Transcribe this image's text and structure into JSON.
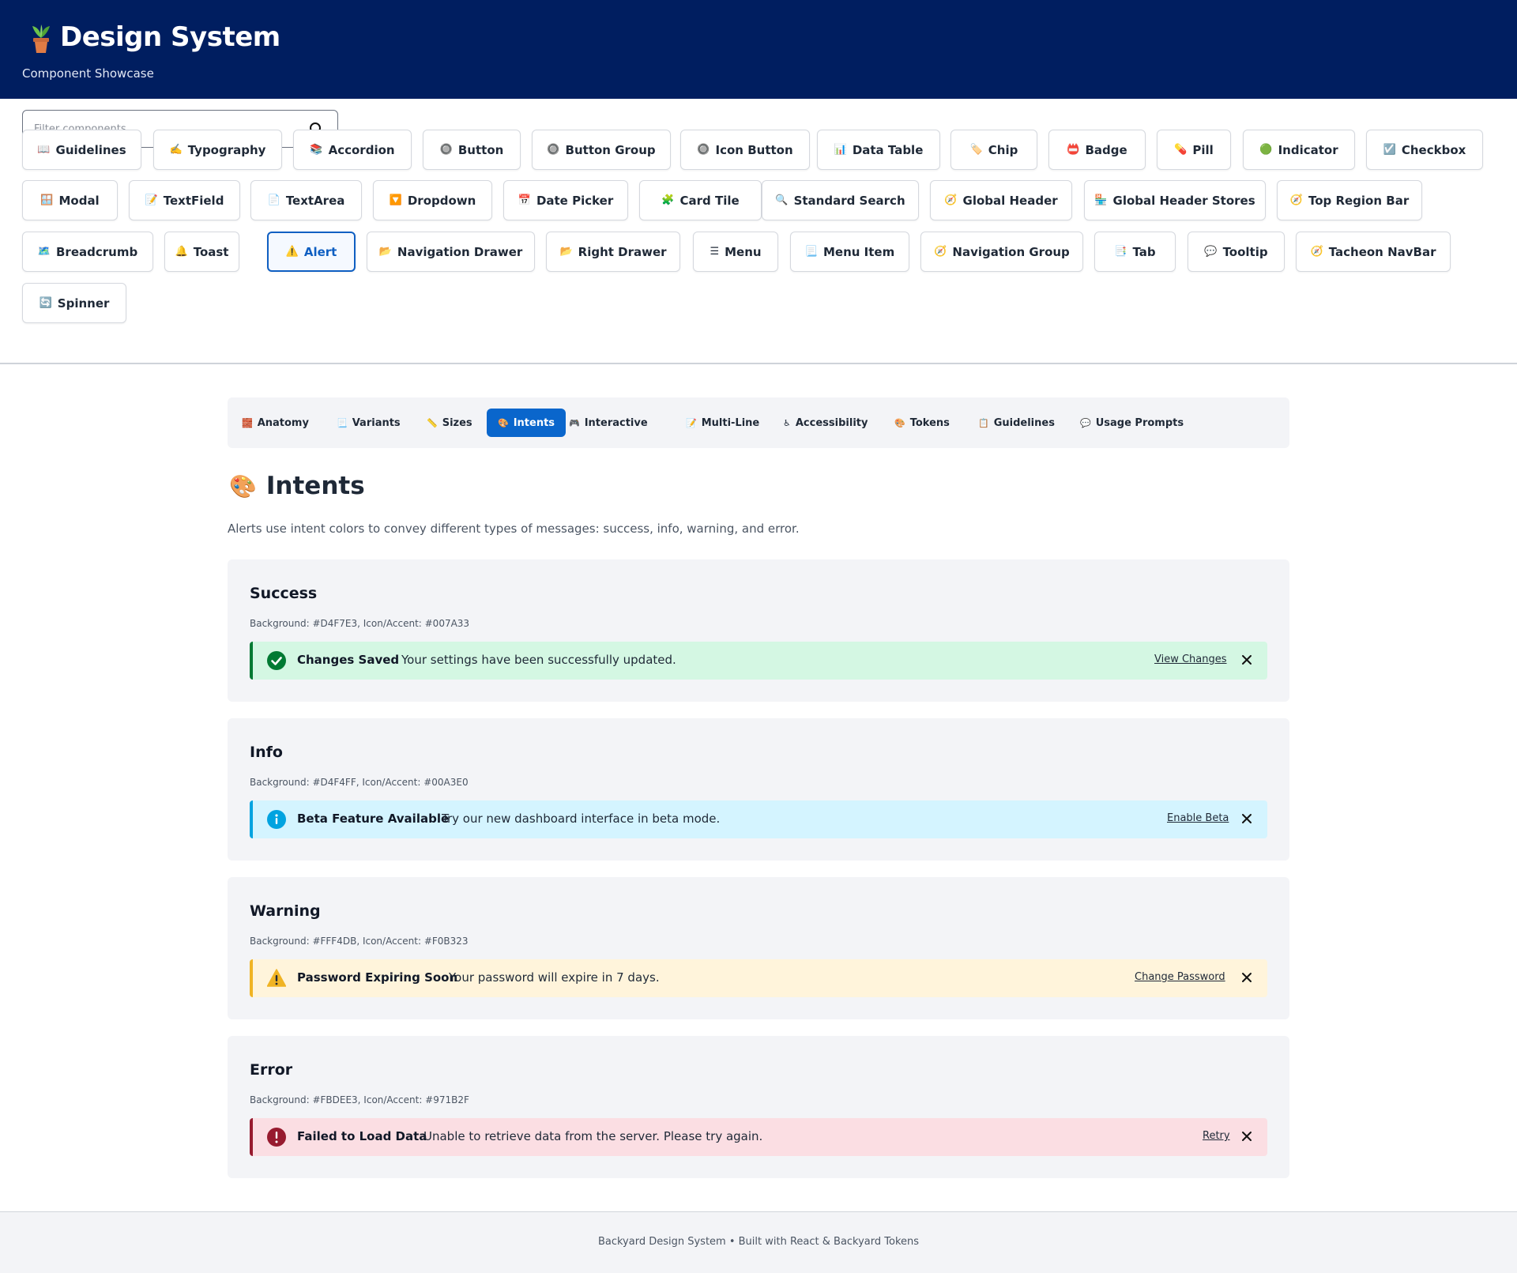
{
  "header": {
    "logo_icon": "potted-plant-icon",
    "title": "Design System",
    "subtitle": "Component Showcase",
    "bg_color": "#001E60"
  },
  "search": {
    "placeholder": "Filter components...",
    "value": "",
    "icon": "search-icon"
  },
  "components": [
    {
      "emoji": "📖",
      "label": "Guidelines"
    },
    {
      "emoji": "✍️",
      "label": "Typography"
    },
    {
      "emoji": "📚",
      "label": "Accordion"
    },
    {
      "emoji": "🔘",
      "label": "Button"
    },
    {
      "emoji": "🔘",
      "label": "Button Group"
    },
    {
      "emoji": "🔘",
      "label": "Icon Button"
    },
    {
      "emoji": "📊",
      "label": "Data Table"
    },
    {
      "emoji": "🏷️",
      "label": "Chip"
    },
    {
      "emoji": "📛",
      "label": "Badge"
    },
    {
      "emoji": "💊",
      "label": "Pill"
    },
    {
      "emoji": "🟢",
      "label": "Indicator"
    },
    {
      "emoji": "☑️",
      "label": "Checkbox"
    },
    {
      "emoji": "🪟",
      "label": "Modal"
    },
    {
      "emoji": "📝",
      "label": "TextField"
    },
    {
      "emoji": "📄",
      "label": "TextArea"
    },
    {
      "emoji": "🔽",
      "label": "Dropdown"
    },
    {
      "emoji": "📅",
      "label": "Date Picker"
    },
    {
      "emoji": "🧩",
      "label": "Card Tile"
    },
    {
      "emoji": "🔍",
      "label": "Standard Search"
    },
    {
      "emoji": "🧭",
      "label": "Global Header"
    },
    {
      "emoji": "🏪",
      "label": "Global Header Stores"
    },
    {
      "emoji": "🧭",
      "label": "Top Region Bar"
    },
    {
      "emoji": "🗺️",
      "label": "Breadcrumb"
    },
    {
      "emoji": "🔔",
      "label": "Toast"
    },
    {
      "emoji": "⚠️",
      "label": "Alert"
    },
    {
      "emoji": "📂",
      "label": "Navigation Drawer"
    },
    {
      "emoji": "📂",
      "label": "Right Drawer"
    },
    {
      "emoji": "☰",
      "label": "Menu"
    },
    {
      "emoji": "📃",
      "label": "Menu Item"
    },
    {
      "emoji": "🧭",
      "label": "Navigation Group"
    },
    {
      "emoji": "📑",
      "label": "Tab"
    },
    {
      "emoji": "💬",
      "label": "Tooltip"
    },
    {
      "emoji": "🧭",
      "label": "Tacheon NavBar"
    },
    {
      "emoji": "🔄",
      "label": "Spinner"
    }
  ],
  "active_component": "Alert",
  "tabs": [
    {
      "emoji": "🧱",
      "label": "Anatomy"
    },
    {
      "emoji": "📃",
      "label": "Variants"
    },
    {
      "emoji": "📏",
      "label": "Sizes"
    },
    {
      "emoji": "🎨",
      "label": "Intents"
    },
    {
      "emoji": "🎮",
      "label": "Interactive"
    },
    {
      "emoji": "📝",
      "label": "Multi-Line"
    },
    {
      "emoji": "♿",
      "label": "Accessibility"
    },
    {
      "emoji": "🎨",
      "label": "Tokens"
    },
    {
      "emoji": "📋",
      "label": "Guidelines"
    },
    {
      "emoji": "💬",
      "label": "Usage Prompts"
    }
  ],
  "active_tab": "Intents",
  "section": {
    "emoji": "🎨",
    "title": "Intents",
    "description": "Alerts use intent colors to convey different types of messages: success, info, warning, and error."
  },
  "intents": [
    {
      "heading": "Success",
      "meta": "Background: #D4F7E3, Icon/Accent: #007A33",
      "bg": "#D4F7E3",
      "accent": "#007A33",
      "icon": "check-circle-icon",
      "alert_title": "Changes Saved",
      "alert_message": "Your settings have been successfully updated.",
      "link": "View Changes"
    },
    {
      "heading": "Info",
      "meta": "Background: #D4F4FF, Icon/Accent: #00A3E0",
      "bg": "#D4F4FF",
      "accent": "#00A3E0",
      "icon": "info-circle-icon",
      "alert_title": "Beta Feature Available",
      "alert_message": "Try our new dashboard interface in beta mode.",
      "link": "Enable Beta"
    },
    {
      "heading": "Warning",
      "meta": "Background: #FFF4DB, Icon/Accent: #F0B323",
      "bg": "#FFF4DB",
      "accent": "#F0B323",
      "icon": "warning-triangle-icon",
      "alert_title": "Password Expiring Soon",
      "alert_message": "Your password will expire in 7 days.",
      "link": "Change Password"
    },
    {
      "heading": "Error",
      "meta": "Background: #FBDEE3, Icon/Accent: #971B2F",
      "bg": "#FBDEE3",
      "accent": "#971B2F",
      "icon": "error-circle-icon",
      "alert_title": "Failed to Load Data",
      "alert_message": "Unable to retrieve data from the server. Please try again.",
      "link": "Retry"
    }
  ],
  "footer": {
    "text": "Backyard Design System • Built with React & Backyard Tokens"
  }
}
